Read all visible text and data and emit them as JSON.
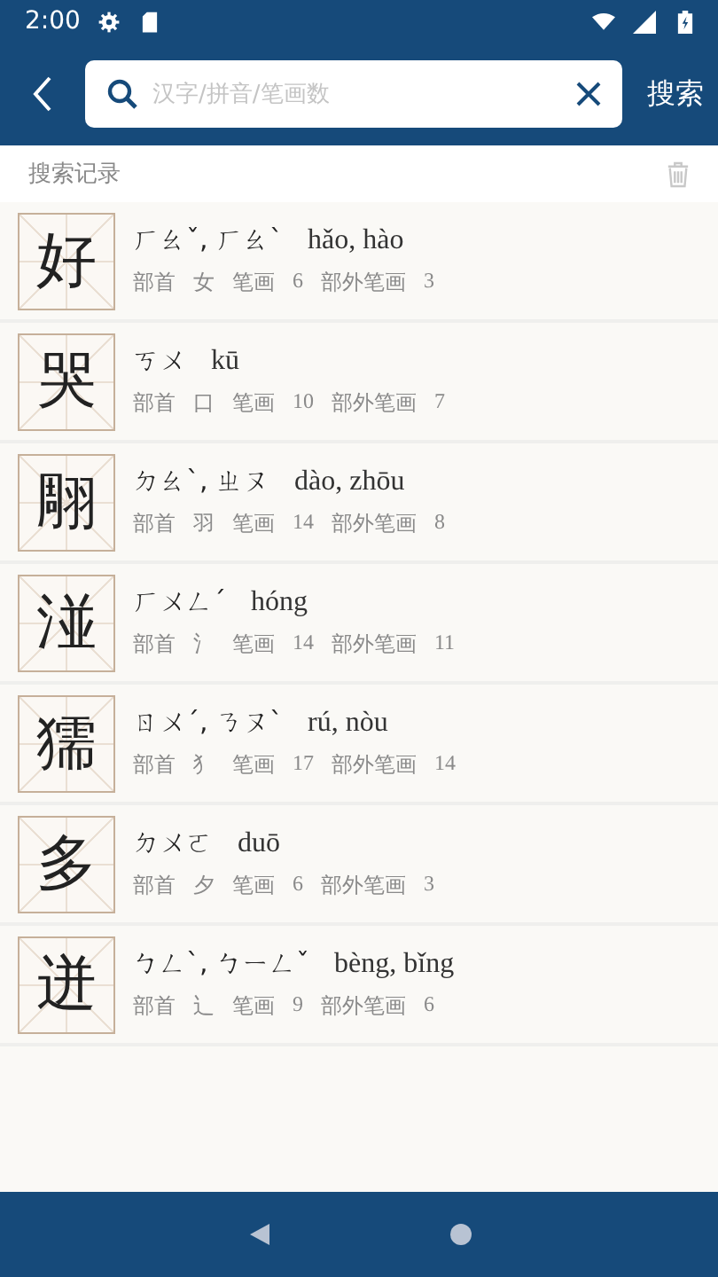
{
  "status_bar": {
    "time": "2:00"
  },
  "header": {
    "search": {
      "placeholder": "汉字/拼音/笔画数"
    },
    "search_button": "搜索"
  },
  "history": {
    "title": "搜索记录"
  },
  "entries": [
    {
      "char": "好",
      "zhuyin": "ㄏㄠˇ, ㄏㄠˋ",
      "pinyin": "hǎo, hào",
      "radical_label": "部首",
      "radical": "女",
      "strokes_label": "笔画",
      "strokes": "6",
      "extra_label": "部外笔画",
      "extra": "3"
    },
    {
      "char": "哭",
      "zhuyin": "ㄎㄨ",
      "pinyin": "kū",
      "radical_label": "部首",
      "radical": "口",
      "strokes_label": "笔画",
      "strokes": "10",
      "extra_label": "部外笔画",
      "extra": "7"
    },
    {
      "char": "翢",
      "zhuyin": "ㄉㄠˋ, ㄓㄡ",
      "pinyin": "dào, zhōu",
      "radical_label": "部首",
      "radical": "羽",
      "strokes_label": "笔画",
      "strokes": "14",
      "extra_label": "部外笔画",
      "extra": "8"
    },
    {
      "char": "湴",
      "zhuyin": "ㄏㄨㄥˊ",
      "pinyin": "hóng",
      "radical_label": "部首",
      "radical": "氵",
      "strokes_label": "笔画",
      "strokes": "14",
      "extra_label": "部外笔画",
      "extra": "11"
    },
    {
      "char": "獳",
      "zhuyin": "ㄖㄨˊ, ㄋㄡˋ",
      "pinyin": "rú, nòu",
      "radical_label": "部首",
      "radical": "犭",
      "strokes_label": "笔画",
      "strokes": "17",
      "extra_label": "部外笔画",
      "extra": "14"
    },
    {
      "char": "多",
      "zhuyin": "ㄉㄨㄛ",
      "pinyin": "duō",
      "radical_label": "部首",
      "radical": "夕",
      "strokes_label": "笔画",
      "strokes": "6",
      "extra_label": "部外笔画",
      "extra": "3"
    },
    {
      "char": "迸",
      "zhuyin": "ㄅㄥˋ, ㄅㄧㄥˇ",
      "pinyin": "bèng, bǐng",
      "radical_label": "部首",
      "radical": "辶",
      "strokes_label": "笔画",
      "strokes": "9",
      "extra_label": "部外笔画",
      "extra": "6"
    }
  ]
}
